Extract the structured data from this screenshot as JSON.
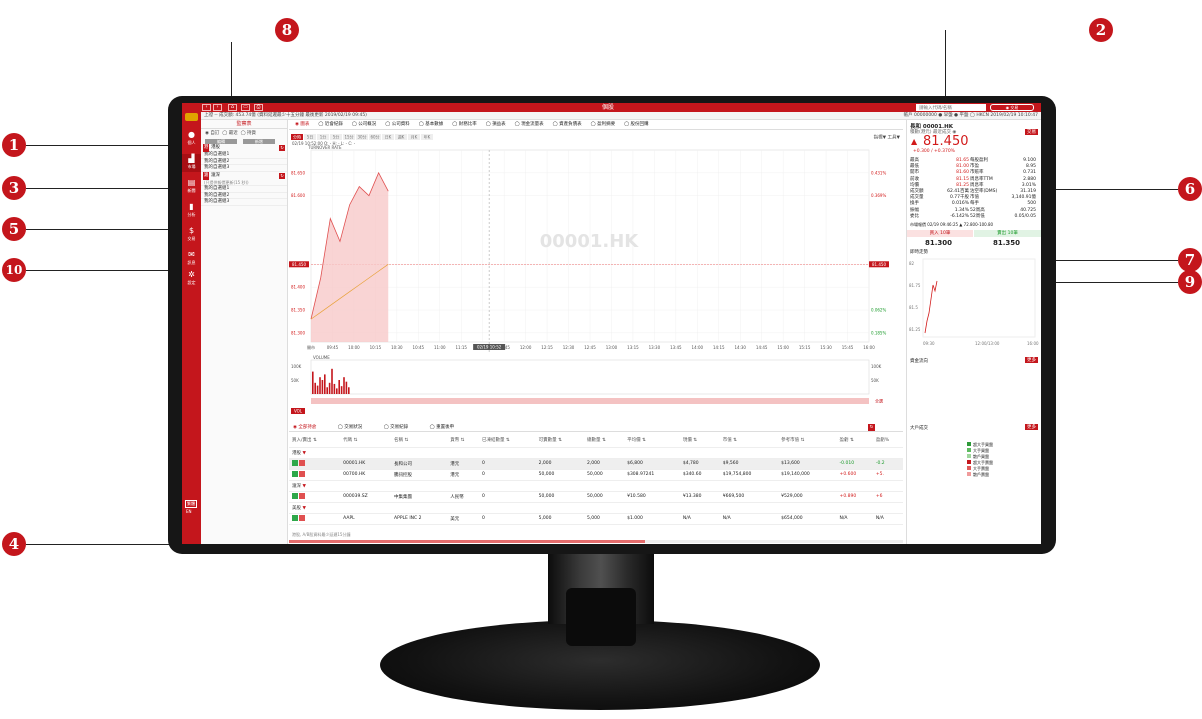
{
  "callouts": [
    "1",
    "2",
    "3",
    "4",
    "5",
    "6",
    "7",
    "8",
    "9",
    "10"
  ],
  "app": {
    "title": "個股",
    "search_placeholder": "請輸入代碼/名稱",
    "status_text": "上證 -- 成交額: 453.74億 (資料延遲最少十五分鐘 最後更新 2019/02/19 09:45)",
    "account_text": "帳戶 00000000 ● 早盤 ● 平盤 ◯ HKCN 2019/02/19 10:10:47",
    "sidebar": [
      {
        "icon": "user-icon",
        "label": "個人"
      },
      {
        "icon": "market-icon",
        "label": "市場"
      },
      {
        "icon": "news-icon",
        "label": "新聞"
      },
      {
        "icon": "chart-icon",
        "label": "分析"
      },
      {
        "icon": "dollar-icon",
        "label": "交易"
      },
      {
        "icon": "mail-icon",
        "label": "訊息"
      },
      {
        "icon": "gear-icon",
        "label": "設定"
      }
    ],
    "sidebar_bottom": [
      "繁體",
      "EN"
    ]
  },
  "watchlist": {
    "title": "監察表",
    "radios": [
      "自訂",
      "最近",
      "持貨"
    ],
    "buttons": [
      "編輯",
      "新增"
    ],
    "groups": [
      {
        "tag": "港",
        "name": "港股",
        "items": [
          "我的自選組1",
          "我的自選組2",
          "我的自選組3"
        ]
      },
      {
        "tag": "滬",
        "name": "滬深",
        "note": "(只提供報價更新(15 秒))",
        "items": [
          "我的自選組1",
          "我的自選組2",
          "我的自選組3"
        ]
      }
    ]
  },
  "tabs": [
    "圖表",
    "近會紀錄",
    "公司概況",
    "公司資料",
    "基本數據",
    "財務比率",
    "損益表",
    "現金流量表",
    "資產負債表",
    "盈利摘要",
    "股份回購"
  ],
  "chart": {
    "period_tabs": [
      "分時",
      "5日",
      "1分",
      "5分",
      "15分",
      "30分",
      "60分",
      "日K",
      "週K",
      "月K",
      "年K"
    ],
    "header": "02/19 10:52:00 O: - H: - L: - C: -",
    "sub": "TURNOVER RATE",
    "watermark": "00001.HK",
    "tools": "指標▼ 工具▼",
    "volume_label": "VOLUME",
    "vol_btn": "VOL",
    "range_btn": "全選",
    "y_left": [
      "81.650",
      "81.600",
      "81.450",
      "81.400",
      "81.350",
      "81.300"
    ],
    "y_right": [
      "0.431%",
      "0.369%",
      "0.306%",
      "0.062%",
      "0.185%"
    ],
    "x_ticks": [
      "開市",
      "09:45",
      "10:00",
      "10:15",
      "10:30",
      "10:45",
      "11:00",
      "11:15",
      "11:30",
      "11:45",
      "12:00",
      "12:15",
      "12:30",
      "12:45",
      "13:00",
      "13:15",
      "13:30",
      "13:45",
      "14:00",
      "14:15",
      "14:30",
      "14:45",
      "15:00",
      "15:15",
      "15:30",
      "15:45",
      "16:00"
    ],
    "cursor_time": "02/19 10:52",
    "vol_left": [
      "100K",
      "50K"
    ],
    "vol_right": [
      "100K",
      "50K"
    ]
  },
  "chart_data": {
    "type": "line",
    "title": "",
    "x": [
      "09:30",
      "09:36",
      "09:42",
      "09:48",
      "09:54",
      "10:00",
      "10:06",
      "10:12",
      "10:18"
    ],
    "series": [
      {
        "name": "",
        "values": [
          81.33,
          81.42,
          81.55,
          81.5,
          81.58,
          81.62,
          81.6,
          81.65,
          81.61
        ]
      }
    ],
    "ylim": [
      81.3,
      81.7
    ],
    "volume": [
      40,
      20,
      15,
      30,
      25,
      35,
      12,
      20,
      45,
      18,
      10,
      25,
      14,
      30,
      22,
      12
    ]
  },
  "quote": {
    "title": "長和 00001.HK",
    "sub": "積數(港元) 最近成交 ◉",
    "price": "81.450",
    "change": "+0.300 / +0.370%",
    "trade_btn": "交易",
    "rows": [
      [
        "最高",
        "81.65",
        "每股盈利",
        "9.100"
      ],
      [
        "最低",
        "81.00",
        "市盈",
        "8.95"
      ],
      [
        "開市",
        "81.60",
        "市賬率",
        "0.731"
      ],
      [
        "前收",
        "81.15",
        "周息率TTM",
        "2.880"
      ],
      [
        "均價",
        "81.25",
        "周息率",
        "3.01%"
      ],
      [
        "成交額",
        "62.41百萬",
        "沽空率(DMS)",
        "31.319"
      ],
      [
        "成交量",
        "0.77千股",
        "市值",
        "3,140.91億"
      ],
      [
        "換手",
        "0.016%",
        "每手",
        "500"
      ],
      [
        "振幅",
        "1.34%",
        "52周高",
        "40.725"
      ],
      [
        "委比",
        "-6.142%",
        "52周低",
        "0.05/0.05"
      ]
    ],
    "time_row": "市場報價 02/19 09:46:25 ▲ 72.800-100.80",
    "bid_label": "買入 10筆",
    "ask_label": "賣出 10筆",
    "bid": "81.300",
    "ask": "81.350",
    "mini_title": "即時走勢",
    "mini_y": [
      "82",
      "81.75",
      "81.5",
      "81.25"
    ],
    "mini_x": [
      "09:30",
      "12:00/13:00",
      "16:00"
    ],
    "flow_title": "資金流向",
    "big_title": "大戶成交",
    "more_btn": "更多",
    "legend": [
      "超大手買盤",
      "大手買盤",
      "散戶買盤",
      "超大手賣盤",
      "大手賣盤",
      "散戶賣盤"
    ]
  },
  "positions": {
    "tabs": [
      "全部持倉",
      "交易狀況",
      "交易紀錄",
      "重置後申"
    ],
    "columns": [
      "買入/賣出",
      "代碼",
      "名稱",
      "貨幣",
      "已凍結數量",
      "可賣數量",
      "總數量",
      "平均價",
      "現價",
      "市值",
      "參考市值",
      "盈虧",
      "盈虧%"
    ],
    "markets": [
      {
        "name": "港股",
        "rows": [
          [
            "00001.HK",
            "長和公司",
            "港元",
            "0",
            "2,000",
            "2,000",
            "$6,800",
            "$4,780",
            "$9,560",
            "$13,600",
            "-0.010",
            "-0.2"
          ],
          [
            "00700.HK",
            "騰訊控股",
            "港元",
            "0",
            "50,000",
            "50,000",
            "$308.97241",
            "$340.60",
            "$19,754,800",
            "$19,140,000",
            "+0.600",
            "+5."
          ]
        ]
      },
      {
        "name": "滬深",
        "rows": [
          [
            "000039.SZ",
            "中集集團",
            "人民幣",
            "0",
            "50,000",
            "50,000",
            "¥10.580",
            "¥13.380",
            "¥669,500",
            "¥529,000",
            "+0.890",
            "+6"
          ]
        ]
      },
      {
        "name": "美股",
        "rows": [
          [
            "AAPL",
            "APPLE INC 2",
            "美元",
            "0",
            "5,000",
            "5,000",
            "$1.000",
            "N/A",
            "N/A",
            "$654,000",
            "N/A",
            "N/A"
          ]
        ]
      }
    ],
    "footer": "港股, A/B股資料最少延遲15分鐘"
  },
  "colors": {
    "accent": "#c4161c",
    "up": "#d21a1a",
    "down": "#1a9a2a"
  }
}
